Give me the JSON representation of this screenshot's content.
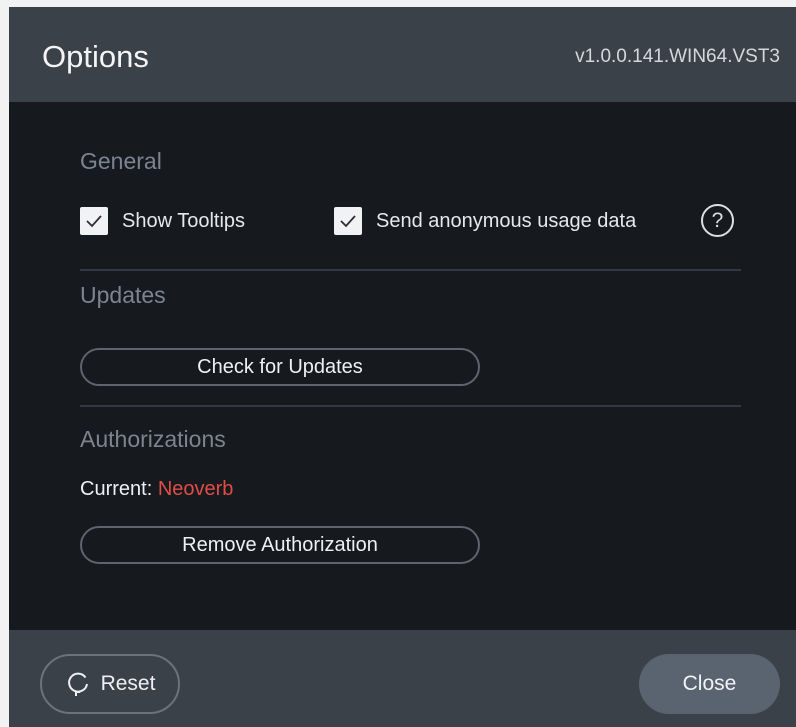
{
  "header": {
    "title": "Options",
    "version": "v1.0.0.141.WIN64.VST3"
  },
  "general": {
    "heading": "General",
    "show_tooltips": {
      "label": "Show Tooltips",
      "checked": true
    },
    "send_usage_data": {
      "label": "Send anonymous usage data",
      "checked": true
    },
    "help_icon": "question-circle-icon",
    "help_glyph": "?"
  },
  "updates": {
    "heading": "Updates",
    "check_button_label": "Check for Updates"
  },
  "authorizations": {
    "heading": "Authorizations",
    "current_label": "Current:",
    "current_value": "Neoverb",
    "remove_button_label": "Remove Authorization"
  },
  "footer": {
    "reset_label": "Reset",
    "reset_icon": "reset-icon",
    "close_label": "Close"
  },
  "colors": {
    "background": "#16191d",
    "header_footer": "#3b4148",
    "section_heading": "#7c858f",
    "accent_red": "#e04d47",
    "close_button": "#5a6470"
  }
}
